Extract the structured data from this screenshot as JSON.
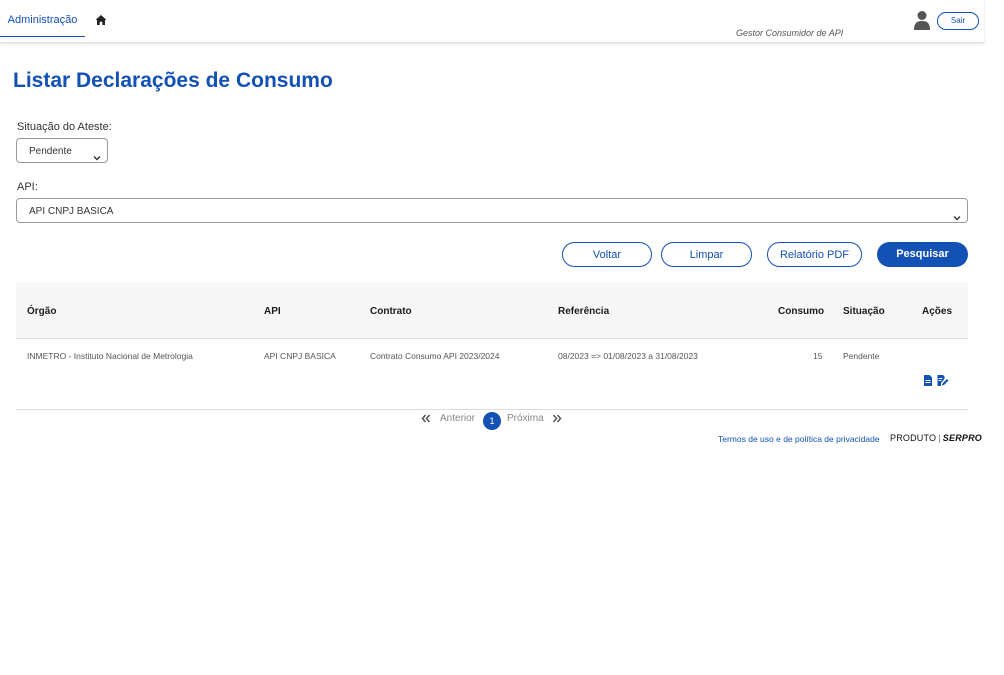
{
  "topbar": {
    "admin_tab": "Administração",
    "role": "Gestor Consumidor de API",
    "logout_label": "Sair"
  },
  "page": {
    "title": "Listar Declarações de Consumo"
  },
  "filters": {
    "ateste_label": "Situação do Ateste:",
    "ateste_value": "Pendente",
    "api_label": "API:",
    "api_value": "API CNPJ BASICA"
  },
  "actions": {
    "back": "Voltar",
    "clear": "Limpar",
    "pdf": "Relatório PDF",
    "search": "Pesquisar"
  },
  "table": {
    "headers": {
      "orgao": "Órgão",
      "api": "API",
      "contrato": "Contrato",
      "referencia": "Referência",
      "consumo": "Consumo",
      "situacao": "Situação",
      "acoes": "Ações"
    },
    "rows": [
      {
        "orgao": "INMETRO - Instituto Nacional de Metrologia",
        "api": "API CNPJ BASICA",
        "contrato": "Contrato Consumo API 2023/2024",
        "referencia": "08/2023 => 01/08/2023 a 31/08/2023",
        "consumo": "15",
        "situacao": "Pendente"
      }
    ]
  },
  "pagination": {
    "prev": "Anterior",
    "current": "1",
    "next": "Próxima"
  },
  "footer": {
    "terms": "Termos de uso e de política de privacidade",
    "brand_left": "PRODUTO",
    "brand_sep": "|",
    "brand_right": "SERPRO"
  },
  "icons": {
    "home": "home-icon",
    "user": "user-icon",
    "chevron": "chevron-down-icon",
    "first": "double-chevron-left-icon",
    "last": "double-chevron-right-icon",
    "document": "document-icon",
    "edit": "edit-icon"
  },
  "colors": {
    "primary": "#1351b4",
    "header_bg": "#f7f7f7"
  }
}
